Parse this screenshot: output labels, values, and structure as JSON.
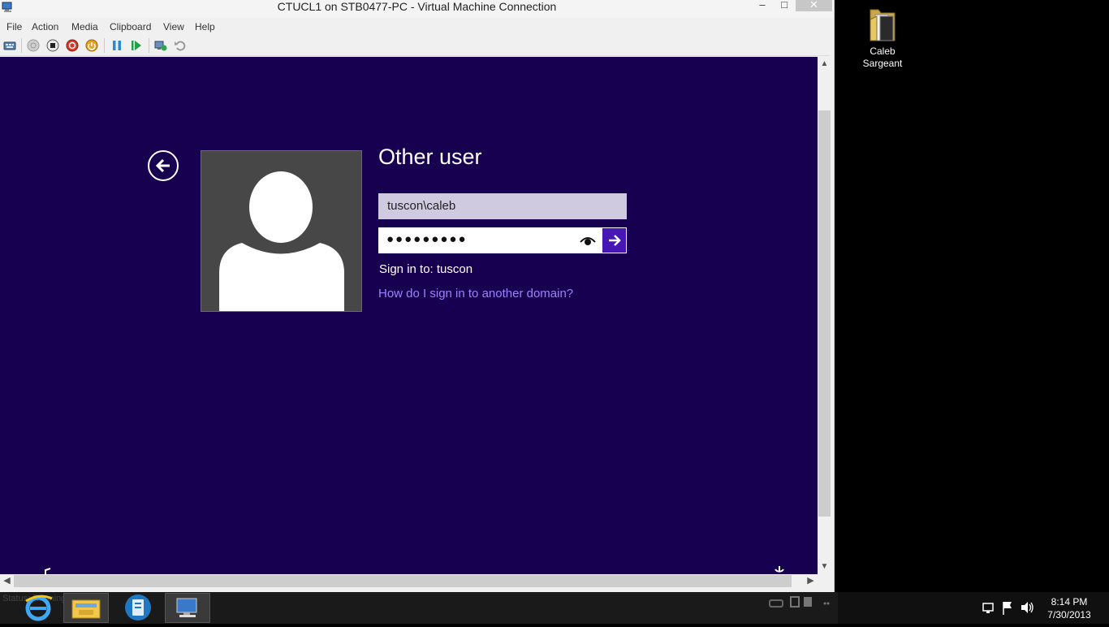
{
  "window": {
    "title": "CTUCL1 on STB0477-PC - Virtual Machine Connection",
    "min_glyph": "–",
    "max_glyph": "□",
    "close_glyph": "✕"
  },
  "menu": {
    "items": [
      "File",
      "Action",
      "Media",
      "Clipboard",
      "View",
      "Help"
    ]
  },
  "toolbar": {
    "buttons": [
      "ctrl-alt-del",
      "start",
      "turn-off",
      "shut-down",
      "save",
      "pause",
      "reset",
      "checkpoint",
      "revert"
    ]
  },
  "login": {
    "title": "Other user",
    "username": "tuscon\\caleb",
    "password_mask": "●●●●●●●●●",
    "sign_in_to": "Sign in to: tuscon",
    "domain_link": "How do I sign in to another domain?"
  },
  "status": {
    "text": "Status: Running"
  },
  "desktop": {
    "icon_label_line1": "Caleb",
    "icon_label_line2": "Sargeant"
  },
  "clock": {
    "time": "8:14 PM",
    "date": "7/30/2013"
  },
  "colors": {
    "vm_background": "#180050",
    "link": "#9f80ff",
    "submit": "#4617b4"
  }
}
